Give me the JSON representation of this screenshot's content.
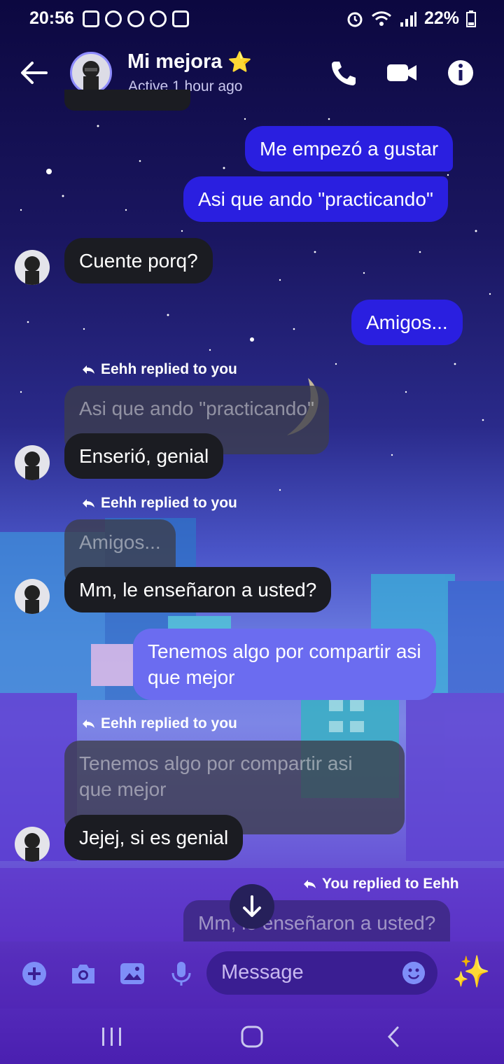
{
  "status_bar": {
    "time": "20:56",
    "battery": "22%"
  },
  "header": {
    "name": "Mi mejora",
    "star": "⭐",
    "status": "Active 1 hour ago"
  },
  "messages": {
    "m1": "Me empezó a gustar",
    "m2": "Asi que ando \"practicando\"",
    "m3": "Cuente porq?",
    "m4": "Amigos...",
    "r1_label": "Eehh replied to you",
    "r1_quote": "Asi que ando \"practicando\"",
    "r1_text": "Enserió, genial",
    "r2_label": "Eehh replied to you",
    "r2_quote": "Amigos...",
    "r2_text": "Mm, le enseñaron a usted?",
    "m5_line1": "Tenemos algo por compartir asi",
    "m5_line2": "que mejor",
    "r3_label": "Eehh replied to you",
    "r3_quote_line1": "Tenemos algo por compartir asi",
    "r3_quote_line2": "que mejor",
    "r3_text": "Jejej, si es genial",
    "r4_label": "You replied to Eehh",
    "r4_quote": "Mm, le enseñaron a usted?"
  },
  "composer": {
    "placeholder": "Message",
    "sparkle": "✨"
  },
  "colors": {
    "outgoing": "#2a1fe0",
    "outgoing_light": "#6b6cf0",
    "incoming": "#1b1c22",
    "accent": "#8e8cff"
  }
}
